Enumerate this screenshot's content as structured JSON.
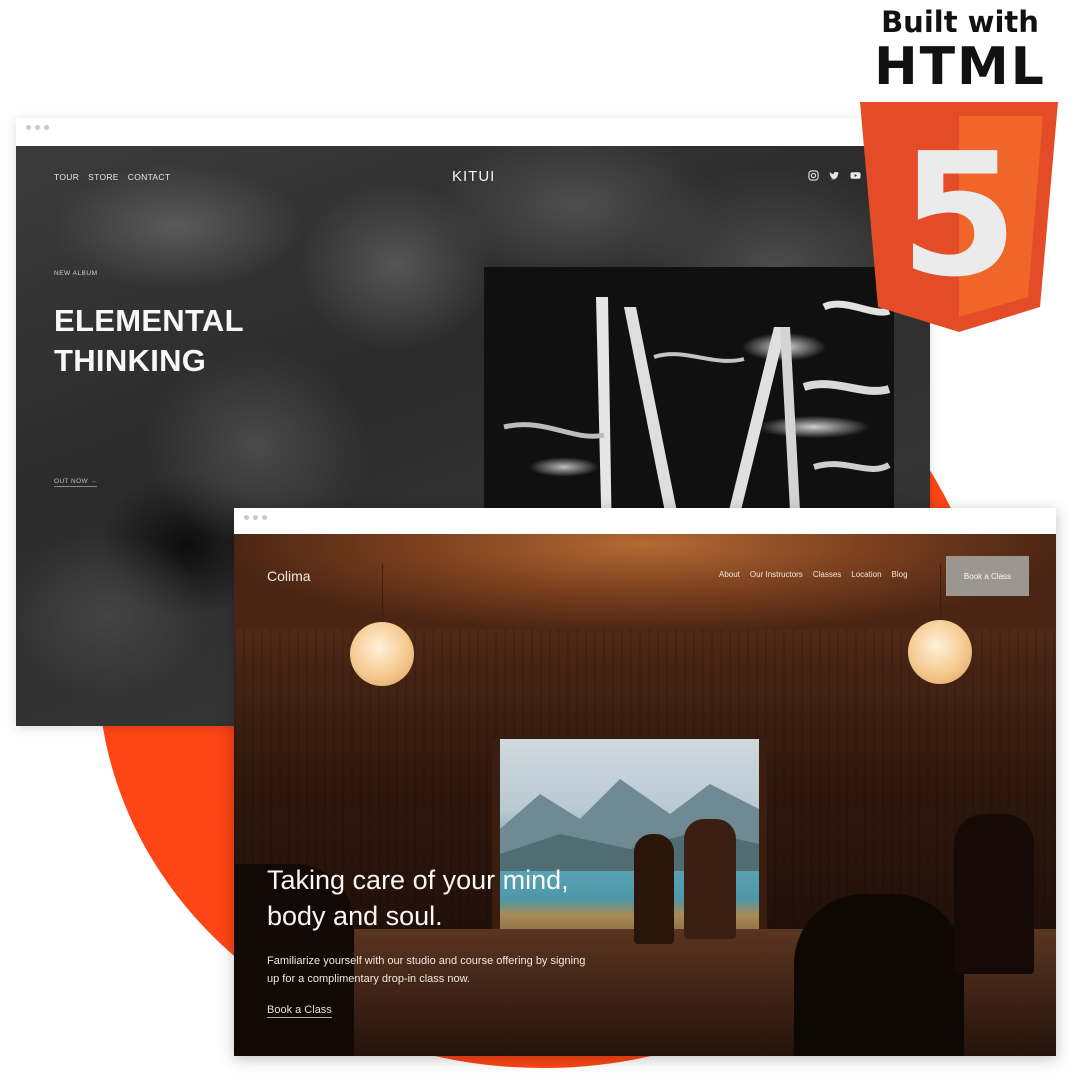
{
  "badge": {
    "line1": "Built with",
    "line2": "HTML",
    "logo_digit": "5",
    "colors": {
      "shield_dark": "#e34c26",
      "shield_light": "#f06529",
      "digit": "#ebebeb"
    }
  },
  "accent_color": "#fd4516",
  "kitui": {
    "nav": [
      "TOUR",
      "STORE",
      "CONTACT"
    ],
    "logo": "KITUI",
    "social_icons": [
      "instagram-icon",
      "twitter-icon",
      "youtube-icon"
    ],
    "eyebrow": "NEW ALBUM",
    "title_line1": "ELEMENTAL",
    "title_line2": "THINKING",
    "cta": "OUT NOW →"
  },
  "colima": {
    "logo": "Colima",
    "nav": [
      "About",
      "Our Instructors",
      "Classes",
      "Location",
      "Blog"
    ],
    "book_button": "Book a Class",
    "headline_line1": "Taking care of your mind,",
    "headline_line2": "body and soul.",
    "subtext_line1": "Familiarize yourself with our studio and course offering by signing",
    "subtext_line2": "up for a complimentary drop-in class now.",
    "cta": "Book a Class"
  }
}
